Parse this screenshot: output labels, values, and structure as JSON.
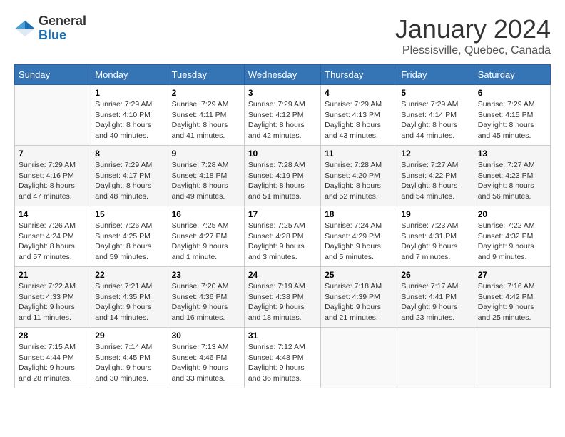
{
  "header": {
    "logo_line1": "General",
    "logo_line2": "Blue",
    "month_year": "January 2024",
    "location": "Plessisville, Quebec, Canada"
  },
  "weekdays": [
    "Sunday",
    "Monday",
    "Tuesday",
    "Wednesday",
    "Thursday",
    "Friday",
    "Saturday"
  ],
  "weeks": [
    [
      {
        "day": "",
        "info": ""
      },
      {
        "day": "1",
        "info": "Sunrise: 7:29 AM\nSunset: 4:10 PM\nDaylight: 8 hours\nand 40 minutes."
      },
      {
        "day": "2",
        "info": "Sunrise: 7:29 AM\nSunset: 4:11 PM\nDaylight: 8 hours\nand 41 minutes."
      },
      {
        "day": "3",
        "info": "Sunrise: 7:29 AM\nSunset: 4:12 PM\nDaylight: 8 hours\nand 42 minutes."
      },
      {
        "day": "4",
        "info": "Sunrise: 7:29 AM\nSunset: 4:13 PM\nDaylight: 8 hours\nand 43 minutes."
      },
      {
        "day": "5",
        "info": "Sunrise: 7:29 AM\nSunset: 4:14 PM\nDaylight: 8 hours\nand 44 minutes."
      },
      {
        "day": "6",
        "info": "Sunrise: 7:29 AM\nSunset: 4:15 PM\nDaylight: 8 hours\nand 45 minutes."
      }
    ],
    [
      {
        "day": "7",
        "info": "Sunrise: 7:29 AM\nSunset: 4:16 PM\nDaylight: 8 hours\nand 47 minutes."
      },
      {
        "day": "8",
        "info": "Sunrise: 7:29 AM\nSunset: 4:17 PM\nDaylight: 8 hours\nand 48 minutes."
      },
      {
        "day": "9",
        "info": "Sunrise: 7:28 AM\nSunset: 4:18 PM\nDaylight: 8 hours\nand 49 minutes."
      },
      {
        "day": "10",
        "info": "Sunrise: 7:28 AM\nSunset: 4:19 PM\nDaylight: 8 hours\nand 51 minutes."
      },
      {
        "day": "11",
        "info": "Sunrise: 7:28 AM\nSunset: 4:20 PM\nDaylight: 8 hours\nand 52 minutes."
      },
      {
        "day": "12",
        "info": "Sunrise: 7:27 AM\nSunset: 4:22 PM\nDaylight: 8 hours\nand 54 minutes."
      },
      {
        "day": "13",
        "info": "Sunrise: 7:27 AM\nSunset: 4:23 PM\nDaylight: 8 hours\nand 56 minutes."
      }
    ],
    [
      {
        "day": "14",
        "info": "Sunrise: 7:26 AM\nSunset: 4:24 PM\nDaylight: 8 hours\nand 57 minutes."
      },
      {
        "day": "15",
        "info": "Sunrise: 7:26 AM\nSunset: 4:25 PM\nDaylight: 8 hours\nand 59 minutes."
      },
      {
        "day": "16",
        "info": "Sunrise: 7:25 AM\nSunset: 4:27 PM\nDaylight: 9 hours\nand 1 minute."
      },
      {
        "day": "17",
        "info": "Sunrise: 7:25 AM\nSunset: 4:28 PM\nDaylight: 9 hours\nand 3 minutes."
      },
      {
        "day": "18",
        "info": "Sunrise: 7:24 AM\nSunset: 4:29 PM\nDaylight: 9 hours\nand 5 minutes."
      },
      {
        "day": "19",
        "info": "Sunrise: 7:23 AM\nSunset: 4:31 PM\nDaylight: 9 hours\nand 7 minutes."
      },
      {
        "day": "20",
        "info": "Sunrise: 7:22 AM\nSunset: 4:32 PM\nDaylight: 9 hours\nand 9 minutes."
      }
    ],
    [
      {
        "day": "21",
        "info": "Sunrise: 7:22 AM\nSunset: 4:33 PM\nDaylight: 9 hours\nand 11 minutes."
      },
      {
        "day": "22",
        "info": "Sunrise: 7:21 AM\nSunset: 4:35 PM\nDaylight: 9 hours\nand 14 minutes."
      },
      {
        "day": "23",
        "info": "Sunrise: 7:20 AM\nSunset: 4:36 PM\nDaylight: 9 hours\nand 16 minutes."
      },
      {
        "day": "24",
        "info": "Sunrise: 7:19 AM\nSunset: 4:38 PM\nDaylight: 9 hours\nand 18 minutes."
      },
      {
        "day": "25",
        "info": "Sunrise: 7:18 AM\nSunset: 4:39 PM\nDaylight: 9 hours\nand 21 minutes."
      },
      {
        "day": "26",
        "info": "Sunrise: 7:17 AM\nSunset: 4:41 PM\nDaylight: 9 hours\nand 23 minutes."
      },
      {
        "day": "27",
        "info": "Sunrise: 7:16 AM\nSunset: 4:42 PM\nDaylight: 9 hours\nand 25 minutes."
      }
    ],
    [
      {
        "day": "28",
        "info": "Sunrise: 7:15 AM\nSunset: 4:44 PM\nDaylight: 9 hours\nand 28 minutes."
      },
      {
        "day": "29",
        "info": "Sunrise: 7:14 AM\nSunset: 4:45 PM\nDaylight: 9 hours\nand 30 minutes."
      },
      {
        "day": "30",
        "info": "Sunrise: 7:13 AM\nSunset: 4:46 PM\nDaylight: 9 hours\nand 33 minutes."
      },
      {
        "day": "31",
        "info": "Sunrise: 7:12 AM\nSunset: 4:48 PM\nDaylight: 9 hours\nand 36 minutes."
      },
      {
        "day": "",
        "info": ""
      },
      {
        "day": "",
        "info": ""
      },
      {
        "day": "",
        "info": ""
      }
    ]
  ]
}
